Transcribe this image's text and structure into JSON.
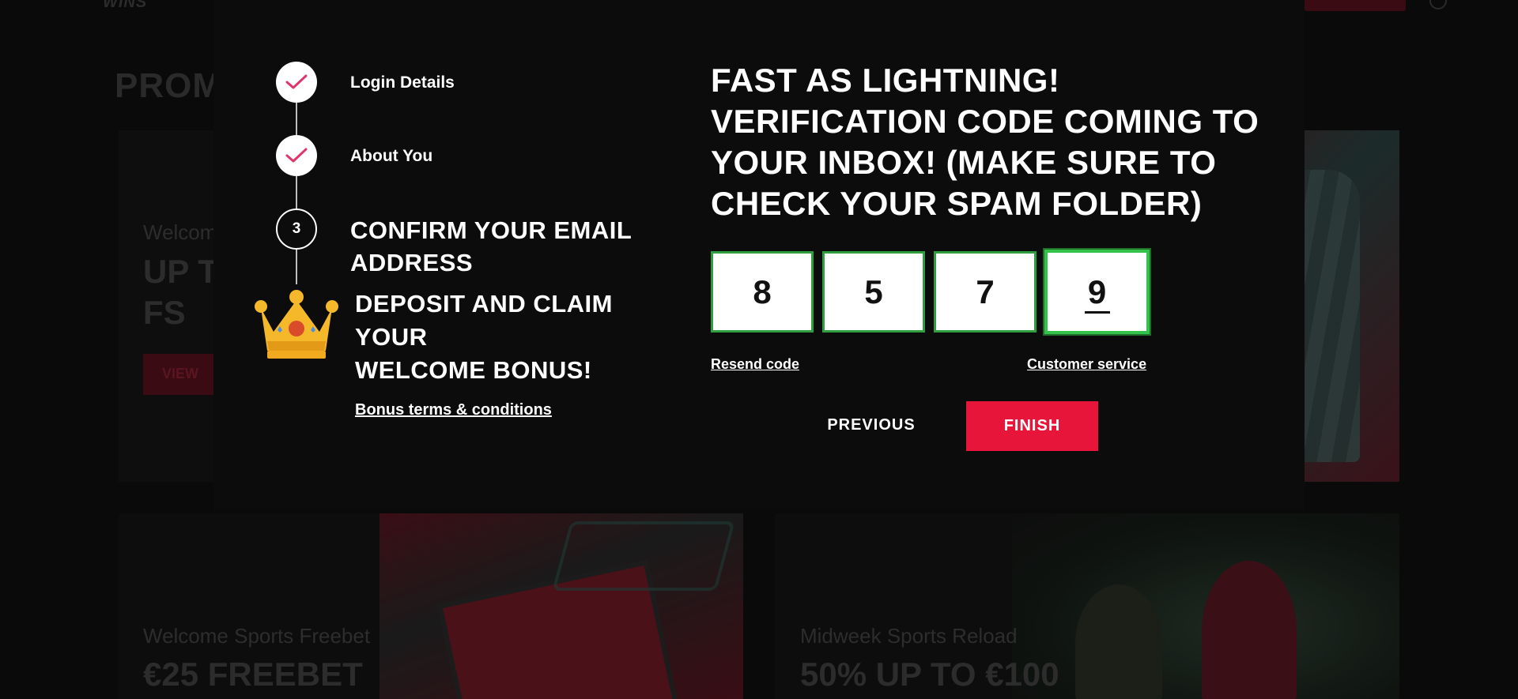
{
  "background": {
    "logo": "WINS",
    "page_title": "PROM",
    "promo_1": {
      "label": "Welcom",
      "big_line_1": "UP T",
      "big_line_2": "FS",
      "button": "VIEW"
    },
    "promo_2": {
      "label": "Welcome Sports Freebet",
      "big": "€25 FREEBET"
    },
    "promo_3": {
      "label": "Midweek Sports Reload",
      "big": "50% UP TO €100"
    }
  },
  "steps": {
    "step1_label": "Login Details",
    "step2_label": "About You",
    "step3_number": "3",
    "step3_label": "CONFIRM YOUR EMAIL ADDRESS",
    "bonus_line_1": "DEPOSIT AND CLAIM",
    "bonus_line_2": "YOUR",
    "bonus_line_3": "WELCOME BONUS!",
    "bonus_terms": "Bonus terms & conditions"
  },
  "verification": {
    "headline": "FAST AS LIGHTNING! VERIFICATION CODE COMING TO YOUR INBOX! (MAKE SURE TO CHECK YOUR SPAM FOLDER)",
    "digits": [
      "8",
      "5",
      "7",
      "9"
    ],
    "resend": "Resend code",
    "customer_service": "Customer service"
  },
  "actions": {
    "previous": "PREVIOUS",
    "finish": "FINISH"
  },
  "colors": {
    "accent_red": "#e8153a",
    "code_border_green": "#2e9e3f",
    "check_pink": "#e0356a"
  },
  "icons": {
    "check": "check-icon",
    "crown": "crown-icon"
  }
}
